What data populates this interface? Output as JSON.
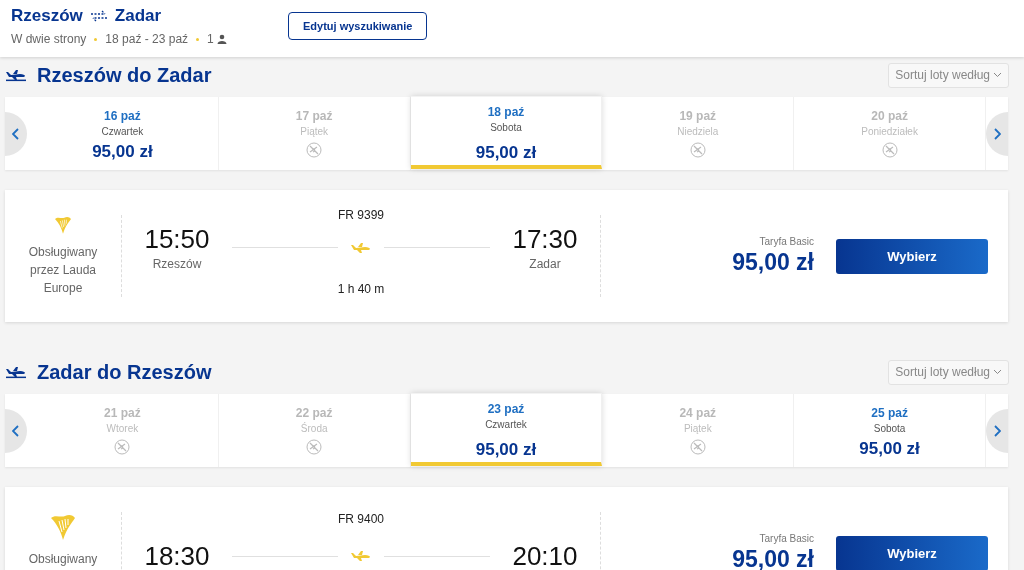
{
  "header": {
    "origin": "Rzeszów",
    "destination": "Zadar",
    "trip_type": "W dwie strony",
    "dates": "18 paź - 23 paź",
    "passengers": "1",
    "edit_button": "Edytuj wyszukiwanie"
  },
  "sections": [
    {
      "title": "Rzeszów do Zadar",
      "sort_label": "Sortuj loty według",
      "dates": [
        {
          "date": "16 paź",
          "day": "Czwartek",
          "available": true,
          "price": "95,00 zł",
          "selected": false
        },
        {
          "date": "17 paź",
          "day": "Piątek",
          "available": false,
          "selected": false
        },
        {
          "date": "18 paź",
          "day": "Sobota",
          "available": true,
          "price": "95,00 zł",
          "selected": true
        },
        {
          "date": "19 paź",
          "day": "Niedziela",
          "available": false,
          "selected": false
        },
        {
          "date": "20 paź",
          "day": "Poniedziałek",
          "available": false,
          "selected": false
        }
      ],
      "flight": {
        "operator": "Obsługiwany przez Lauda Europe",
        "flight_number": "FR 9399",
        "departure_time": "15:50",
        "departure_city": "Rzeszów",
        "arrival_time": "17:30",
        "arrival_city": "Zadar",
        "duration": "1 h 40 m",
        "fare": "Taryfa Basic",
        "price": "95,00 zł",
        "button": "Wybierz"
      }
    },
    {
      "title": "Zadar do Rzeszów",
      "sort_label": "Sortuj loty według",
      "dates": [
        {
          "date": "21 paź",
          "day": "Wtorek",
          "available": false,
          "selected": false
        },
        {
          "date": "22 paź",
          "day": "Środa",
          "available": false,
          "selected": false
        },
        {
          "date": "23 paź",
          "day": "Czwartek",
          "available": true,
          "price": "95,00 zł",
          "selected": true
        },
        {
          "date": "24 paź",
          "day": "Piątek",
          "available": false,
          "selected": false
        },
        {
          "date": "25 paź",
          "day": "Sobota",
          "available": true,
          "price": "95,00 zł",
          "selected": false
        }
      ],
      "flight": {
        "operator": "Obsługiwany",
        "flight_number": "FR 9400",
        "departure_time": "18:30",
        "arrival_time": "20:10",
        "fare": "Taryfa Basic",
        "price": "95,00 zł",
        "button": "Wybierz"
      }
    }
  ]
}
